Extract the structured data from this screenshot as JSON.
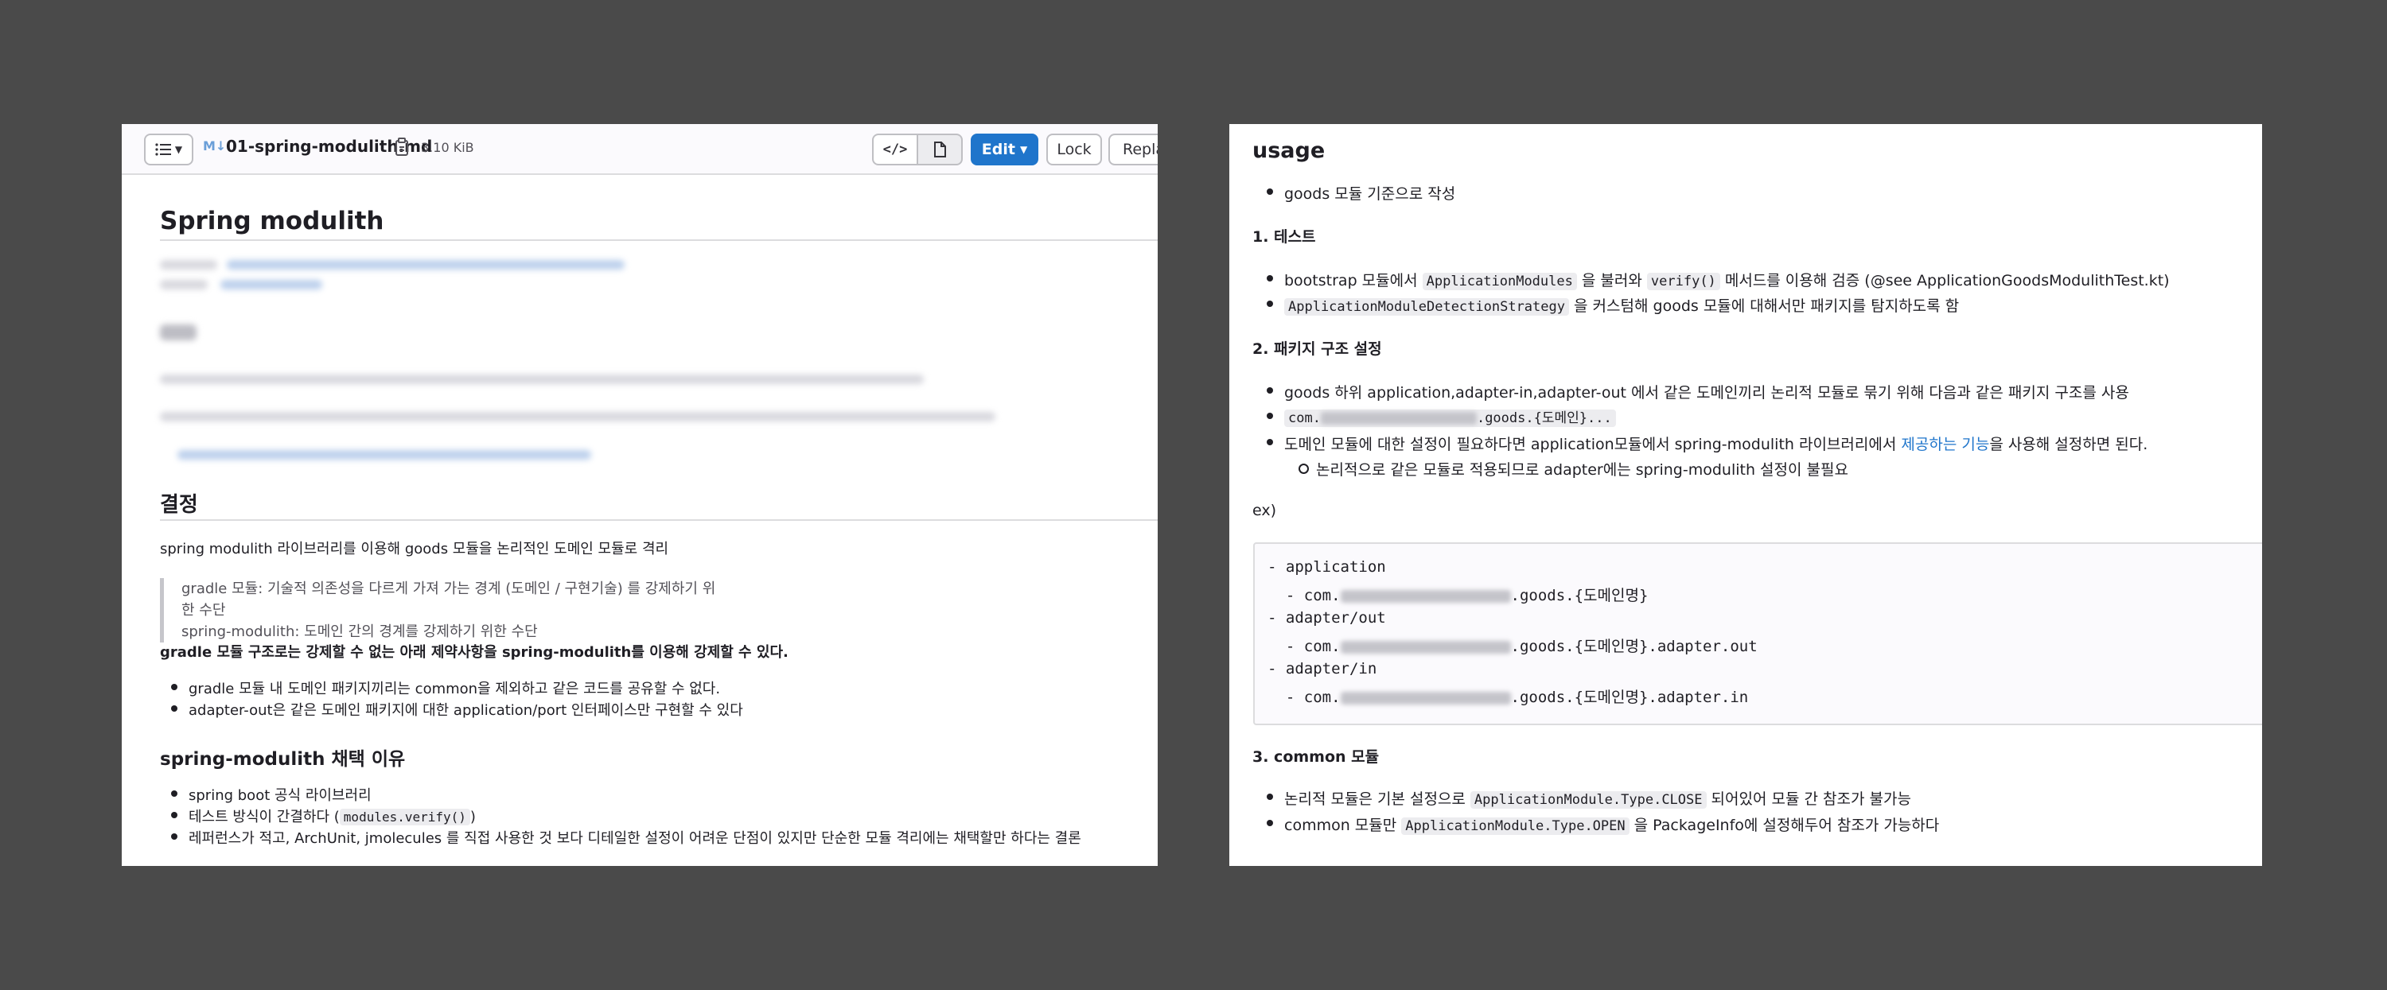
{
  "colors": {
    "background": "#4a4a4a",
    "edit_button": "#1f75cb",
    "link": "#1f75cb"
  },
  "toolbar": {
    "list_icon": "list-icon",
    "file_type_badge": "M↓",
    "filename": "01-spring-modulith.md",
    "filesize": "3.10 KiB",
    "edit_label": "Edit",
    "lock_label": "Lock",
    "replace_label": "Replac"
  },
  "left": {
    "title": "Spring modulith",
    "decision_heading": "결정",
    "decision_text": "spring modulith 라이브러리를 이용해 goods 모듈을 논리적인 도메인 모듈로 격리",
    "quote_line1": "gradle 모듈: 기술적 의존성을 다르게 가져 가는 경계 (도메인 / 구현기술) 를 강제하기 위한 수단",
    "quote_line2": "spring-modulith: 도메인 간의 경계를 강제하기 위한 수단",
    "constraint_text": "gradle 모듈 구조로는 강제할 수 없는 아래 제약사항을 spring-modulith를 이용해 강제할 수 있다.",
    "constraints": [
      "gradle 모듈 내 도메인 패키지끼리는 common을 제외하고 같은 코드를 공유할 수 없다.",
      "adapter-out은 같은 도메인 패키지에 대한 application/port 인터페이스만 구현할 수 있다"
    ],
    "reason_heading": "spring-modulith 채택 이유",
    "reason1": "spring boot 공식 라이브러리",
    "reason2_prefix": "테스트 방식이 간결하다 (",
    "reason2_code": "modules.verify()",
    "reason2_suffix": ")",
    "reason3": "레퍼런스가 적고, ArchUnit, jmolecules 를 직접 사용한 것 보다 디테일한 설정이 어려운 단점이 있지만 단순한 모듈 격리에는 채택할만 하다는 결론"
  },
  "right": {
    "usage_heading": "usage",
    "usage_item": "goods 모듈 기준으로 작성",
    "test_heading": "1. 테스트",
    "test1_a": "bootstrap 모듈에서 ",
    "test1_code1": "ApplicationModules",
    "test1_b": " 을 불러와 ",
    "test1_code2": "verify()",
    "test1_c": " 메서드를 이용해 검증 (@see ApplicationGoodsModulithTest.kt)",
    "test2_code": "ApplicationModuleDetectionStrategy",
    "test2_text": " 을 커스텀해 goods 모듈에 대해서만 패키지를 탐지하도록 함",
    "package_heading": "2. 패키지 구조 설정",
    "pkg1": "goods 하위 application,adapter-in,adapter-out 에서 같은 도메인끼리 논리적 모듈로 묶기 위해 다음과 같은 패키지 구조를 사용",
    "pkg2_prefix": "com.",
    "pkg2_suffix": ".goods.{도메인}...",
    "pkg3_a": "도메인 모듈에 대한 설정이 필요하다면 application모듈에서 spring-modulith 라이브러리에서 ",
    "pkg3_link": "제공하는 기능",
    "pkg3_b": "을 사용해 설정하면 된다.",
    "pkg3_sub": "논리적으로 같은 모듈로 적용되므로 adapter에는 spring-modulith 설정이 불필요",
    "ex_label": "ex)",
    "code_lines": {
      "l1": "- application",
      "l2_prefix": "  - com.",
      "l2_suffix": ".goods.{도메인명}",
      "l3": "- adapter/out",
      "l4_prefix": "  - com.",
      "l4_suffix": ".goods.{도메인명}.adapter.out",
      "l5": "- adapter/in",
      "l6_prefix": "  - com.",
      "l6_suffix": ".goods.{도메인명}.adapter.in"
    },
    "common_heading": "3. common 모듈",
    "common1_a": "논리적 모듈은 기본 설정으로 ",
    "common1_code": "ApplicationModule.Type.CLOSE",
    "common1_b": " 되어있어 모듈 간 참조가 불가능",
    "common2_a": "common 모듈만 ",
    "common2_code": "ApplicationModule.Type.OPEN",
    "common2_b": " 을 PackageInfo에 설정해두어 참조가 가능하다"
  }
}
